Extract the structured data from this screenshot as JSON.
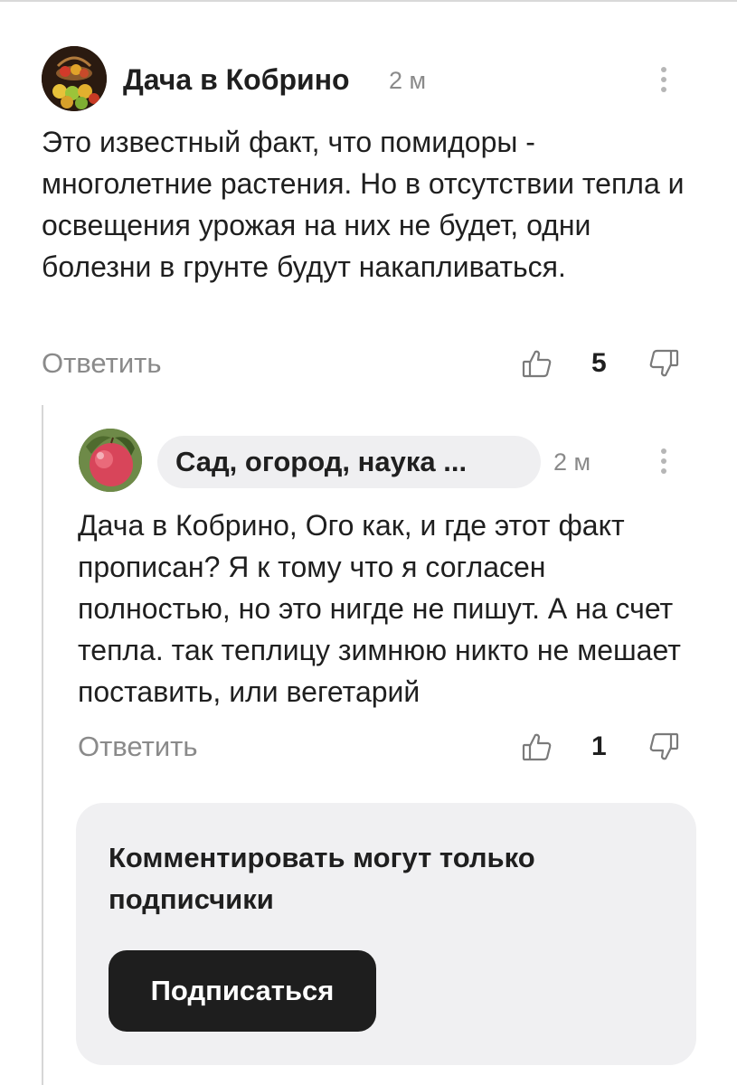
{
  "comments": [
    {
      "author": "Дача в Кобрино",
      "time": "2 м",
      "text": "Это известный факт, что помидоры - многолетние растения. Но в отсутствии тепла и освещения урожая на них не будет, одни болезни в грунте будут накапливаться.",
      "reply_label": "Ответить",
      "likes": "5",
      "avatar_icon": "avatar-fruit-basket"
    },
    {
      "author": "Сад, огород, наука ...",
      "time": "2 м",
      "text": "Дача в Кобрино, Ого как, и где этот факт прописан? Я к тому что я согласен полностью, но это нигде не пишут. А на счет тепла. так теплицу зимнюю никто не мешает поставить, или вегетарий",
      "reply_label": "Ответить",
      "likes": "1",
      "avatar_icon": "avatar-apple"
    }
  ],
  "subscribe_box": {
    "message": "Комментировать могут только подписчики",
    "button_label": "Подписаться"
  },
  "icons": {
    "like": "thumbs-up-icon",
    "dislike": "thumbs-down-icon",
    "more": "more-vertical-icon"
  },
  "colors": {
    "muted_text": "#8a8a8a",
    "pill_bg": "#efeff1",
    "button_bg": "#1e1e1e"
  }
}
